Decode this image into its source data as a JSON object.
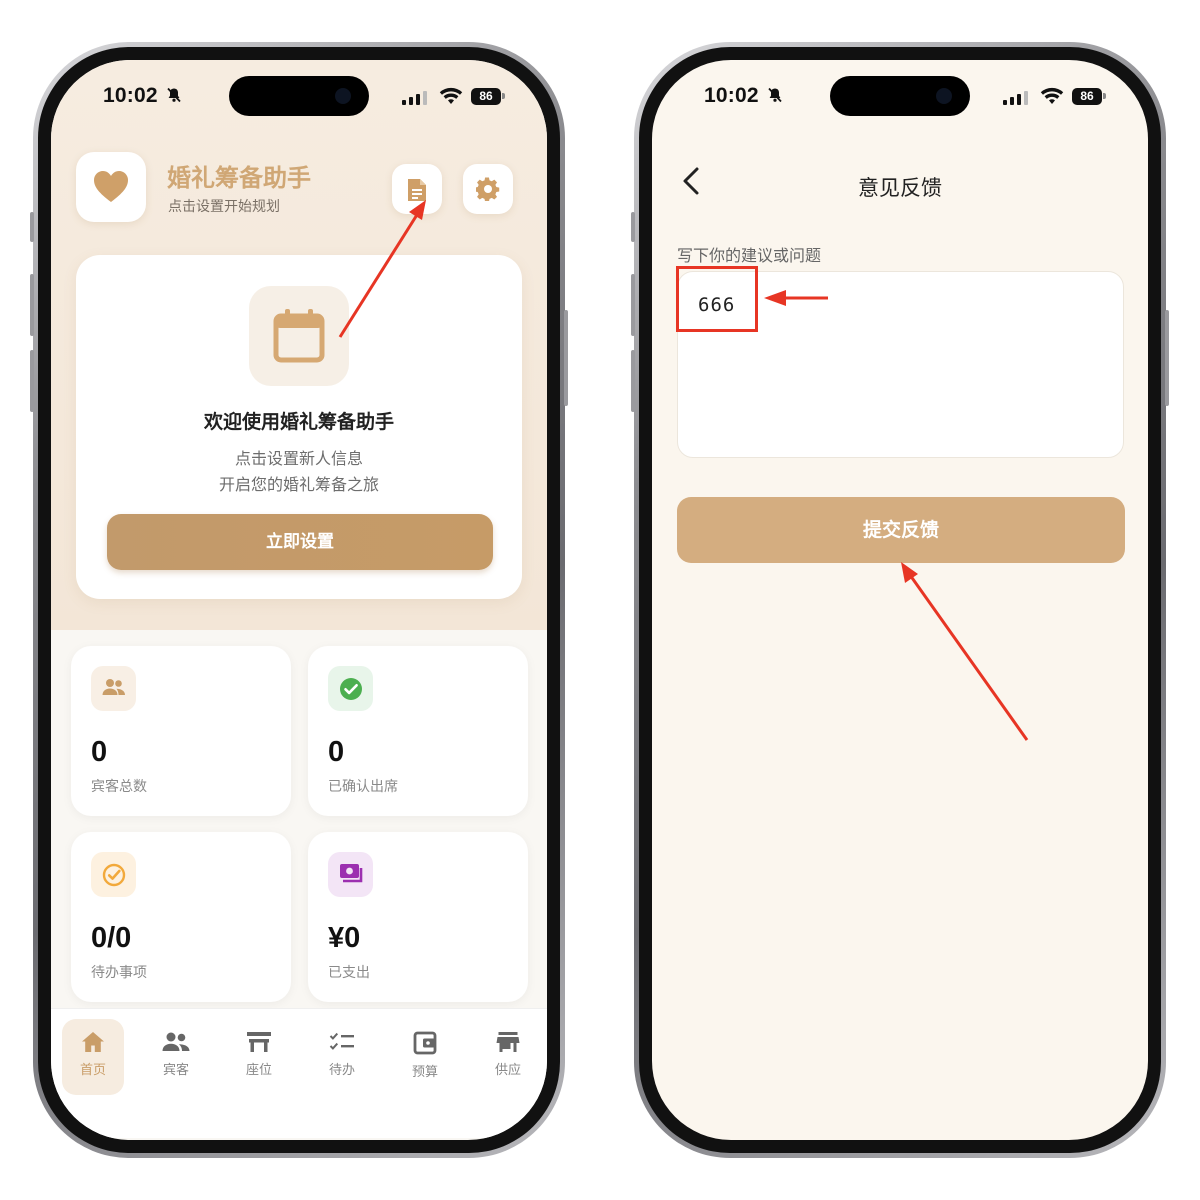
{
  "status_bar": {
    "time": "10:02",
    "battery": "86"
  },
  "left_screen": {
    "app": {
      "title": "婚礼筹备助手",
      "subtitle": "点击设置开始规划"
    },
    "welcome": {
      "title": "欢迎使用婚礼筹备助手",
      "line1": "点击设置新人信息",
      "line2": "开启您的婚礼筹备之旅",
      "button": "立即设置"
    },
    "stats": [
      {
        "value": "0",
        "label": "宾客总数",
        "icon": "guests-icon"
      },
      {
        "value": "0",
        "label": "已确认出席",
        "icon": "check-circle-icon"
      },
      {
        "value": "0/0",
        "label": "待办事项",
        "icon": "todo-check-icon"
      },
      {
        "value": "¥0",
        "label": "已支出",
        "icon": "money-icon"
      }
    ],
    "tabs": [
      {
        "label": "首页",
        "icon": "home-icon",
        "active": true
      },
      {
        "label": "宾客",
        "icon": "people-icon",
        "active": false
      },
      {
        "label": "座位",
        "icon": "table-icon",
        "active": false
      },
      {
        "label": "待办",
        "icon": "checklist-icon",
        "active": false
      },
      {
        "label": "预算",
        "icon": "wallet-icon",
        "active": false
      },
      {
        "label": "供应",
        "icon": "store-icon",
        "active": false
      }
    ]
  },
  "right_screen": {
    "title": "意见反馈",
    "field_label": "写下你的建议或问题",
    "field_value": "666",
    "submit": "提交反馈"
  },
  "colors": {
    "accent": "#c99d68",
    "title_gold": "#d0a775",
    "button_gold": "#d4ad80",
    "annotation_red": "#e73524"
  }
}
